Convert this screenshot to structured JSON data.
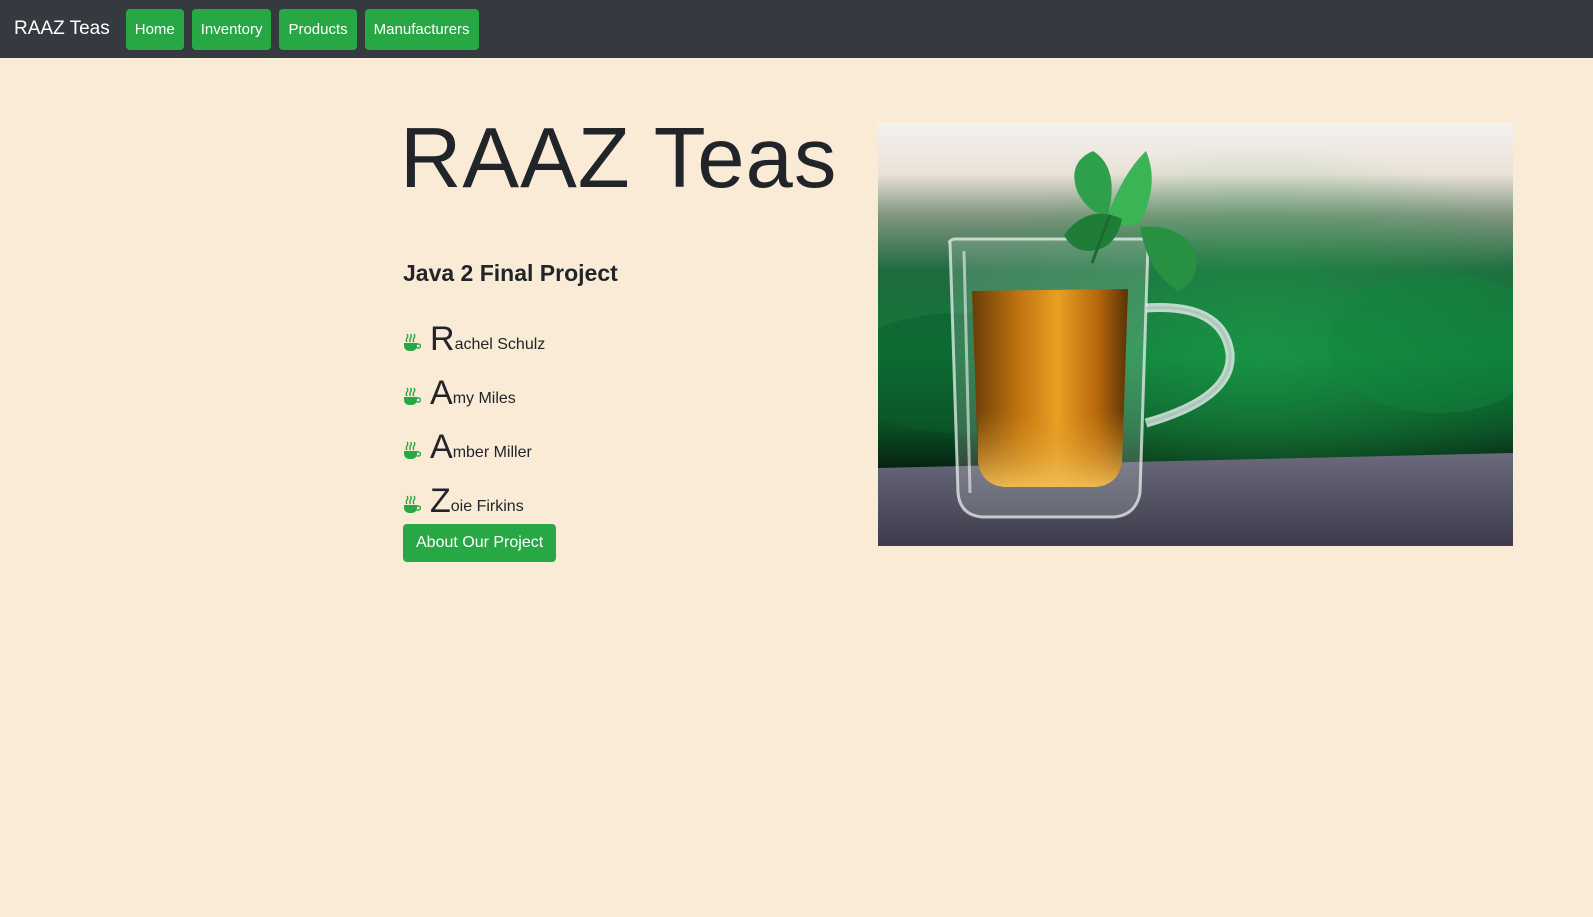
{
  "navbar": {
    "brand": "RAAZ Teas",
    "links": [
      {
        "label": "Home"
      },
      {
        "label": "Inventory"
      },
      {
        "label": "Products"
      },
      {
        "label": "Manufacturers"
      }
    ]
  },
  "hero": {
    "title": "RAAZ Teas",
    "subtitle": "Java 2 Final Project",
    "team": [
      {
        "initial": "R",
        "rest": "achel Schulz"
      },
      {
        "initial": "A",
        "rest": "my Miles"
      },
      {
        "initial": "A",
        "rest": "mber Miller"
      },
      {
        "initial": "Z",
        "rest": "oie Firkins"
      }
    ],
    "about_button": "About Our Project"
  },
  "icons": {
    "list_bullet": "tea-cup-icon"
  },
  "colors": {
    "navbar_bg": "#343a40",
    "accent_green": "#28a745",
    "page_bg": "#faebd7",
    "text": "#212529"
  }
}
